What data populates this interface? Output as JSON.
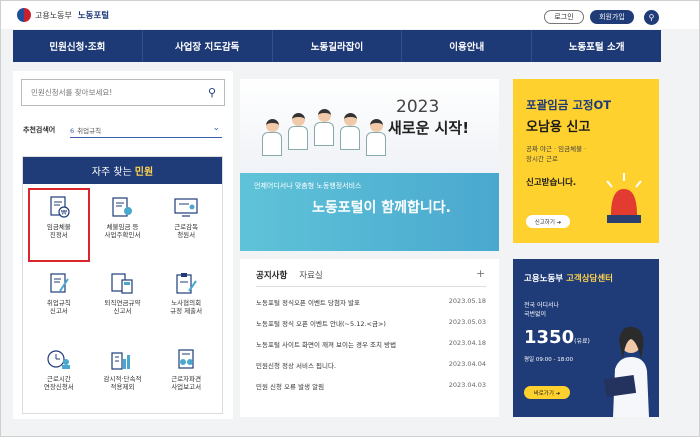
{
  "header": {
    "org": "고용노동부",
    "site": "노동포털",
    "login_label": "로그인",
    "join_label": "회원가입",
    "search_icon": "search-icon"
  },
  "nav": {
    "items": [
      "민원신청·조회",
      "사업장 지도감독",
      "노동길라잡이",
      "이용안내",
      "노동포털 소개"
    ]
  },
  "search": {
    "placeholder": "민원신청서를 찾아보세요!"
  },
  "recommend": {
    "label": "추천검색어",
    "rank": "6",
    "keyword": "취업규칙"
  },
  "frequent": {
    "title_prefix": "자주 찾는",
    "title_highlight": "민원",
    "items": [
      {
        "label": "임금체불\n진정서",
        "icon": "document-coin-icon",
        "selected": true
      },
      {
        "label": "체불임금 등\n사업주확인서",
        "icon": "certificate-icon",
        "selected": false
      },
      {
        "label": "근로감독\n청원서",
        "icon": "monitor-icon",
        "selected": false
      },
      {
        "label": "취업규칙\n신고서",
        "icon": "pencil-document-icon",
        "selected": false
      },
      {
        "label": "퇴직연금규약\n신고서",
        "icon": "calculator-document-icon",
        "selected": false
      },
      {
        "label": "노사협의회\n규정 제출서",
        "icon": "clipboard-pen-icon",
        "selected": false
      },
      {
        "label": "근로시간\n연장신청서",
        "icon": "clock-person-icon",
        "selected": false
      },
      {
        "label": "감시적·단속적\n적용제외",
        "icon": "building-chart-icon",
        "selected": false
      },
      {
        "label": "근로자파견\n사업보고서",
        "icon": "people-document-icon",
        "selected": false
      }
    ]
  },
  "banner": {
    "year": "2023",
    "slogan": "새로운 시작!",
    "subtitle": "언제어디서나 맞춤형 노동행정서비스",
    "main": "노동포털이 함께합니다."
  },
  "notice": {
    "tab_active": "공지사항",
    "tab_other": "자료실",
    "more": "+",
    "rows": [
      {
        "title": "노동포털 정식오픈 이벤트 당첨자 발표",
        "date": "2023.05.18"
      },
      {
        "title": "노동포털 정식 오픈 이벤트 안내(~5.12.<금>)",
        "date": "2023.05.03"
      },
      {
        "title": "노동포털 사이트 화면이 깨져 보이는 경우 조치 방법",
        "date": "2023.04.18"
      },
      {
        "title": "민원신청 정상 서비스 됩니다.",
        "date": "2023.04.04"
      },
      {
        "title": "민원 신청 오류 발생 알림",
        "date": "2023.04.03"
      }
    ]
  },
  "promo_ot": {
    "line1": "포괄임금 고정OT",
    "line2": "오남용 신고",
    "desc1": "공짜 야근 · 임금체불 ·",
    "desc2": "장시간 근로",
    "line3": "신고받습니다.",
    "button": "신고하기 ➔"
  },
  "promo_call": {
    "title_prefix": "고용노동부",
    "title_highlight": "고객상담센터",
    "desc1": "전국 어디서나",
    "desc2": "국번없이",
    "number": "1350",
    "number_suffix": "(유료)",
    "hours": "평일 09:00 - 18:00",
    "button": "바로가기 ➔"
  },
  "colors": {
    "navy": "#1e3a76",
    "yellow": "#ffd12e",
    "teal": "#4aa8cf",
    "highlight_red": "#d9262c"
  }
}
